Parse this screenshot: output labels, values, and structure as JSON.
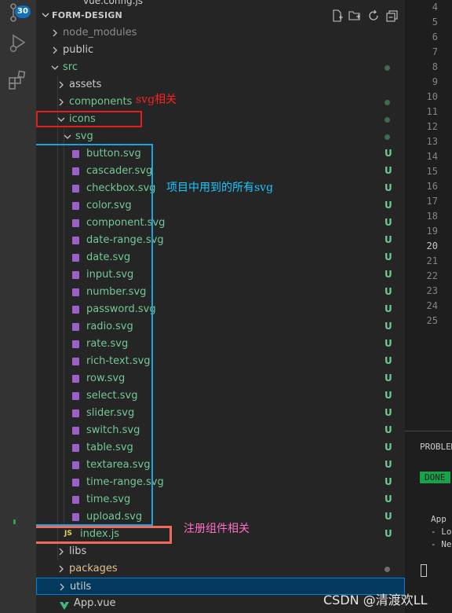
{
  "activity_bar": {
    "scm_badge": "30",
    "icons": [
      "source-control-icon",
      "run-debug-icon",
      "extensions-icon"
    ]
  },
  "explorer": {
    "partial_top_text": "vue.config.js",
    "section_title": "FORM-DESIGN",
    "header_actions": [
      "new-file-icon",
      "new-folder-icon",
      "refresh-icon",
      "collapse-all-icon"
    ],
    "rows": [
      {
        "label": "node_modules",
        "kind": "folder",
        "expanded": false,
        "depth": 0,
        "status": "",
        "color": "#8b8b8b"
      },
      {
        "label": "public",
        "kind": "folder",
        "expanded": false,
        "depth": 0,
        "status": "",
        "color": "#cccccc"
      },
      {
        "label": "src",
        "kind": "folder",
        "expanded": true,
        "depth": 0,
        "status": "dot",
        "color": "#73c991"
      },
      {
        "label": "assets",
        "kind": "folder",
        "expanded": false,
        "depth": 1,
        "status": "",
        "color": "#cccccc"
      },
      {
        "label": "components",
        "kind": "folder",
        "expanded": false,
        "depth": 1,
        "status": "dot",
        "color": "#73c991"
      },
      {
        "label": "icons",
        "kind": "folder",
        "expanded": true,
        "depth": 1,
        "status": "dot",
        "color": "#73c991"
      },
      {
        "label": "svg",
        "kind": "folder",
        "expanded": true,
        "depth": 2,
        "status": "dot",
        "color": "#73c991"
      },
      {
        "label": "button.svg",
        "kind": "svg",
        "depth": 3,
        "status": "U",
        "color": "#73c991"
      },
      {
        "label": "cascader.svg",
        "kind": "svg",
        "depth": 3,
        "status": "U",
        "color": "#73c991"
      },
      {
        "label": "checkbox.svg",
        "kind": "svg",
        "depth": 3,
        "status": "U",
        "color": "#73c991"
      },
      {
        "label": "color.svg",
        "kind": "svg",
        "depth": 3,
        "status": "U",
        "color": "#73c991"
      },
      {
        "label": "component.svg",
        "kind": "svg",
        "depth": 3,
        "status": "U",
        "color": "#73c991"
      },
      {
        "label": "date-range.svg",
        "kind": "svg",
        "depth": 3,
        "status": "U",
        "color": "#73c991"
      },
      {
        "label": "date.svg",
        "kind": "svg",
        "depth": 3,
        "status": "U",
        "color": "#73c991"
      },
      {
        "label": "input.svg",
        "kind": "svg",
        "depth": 3,
        "status": "U",
        "color": "#73c991"
      },
      {
        "label": "number.svg",
        "kind": "svg",
        "depth": 3,
        "status": "U",
        "color": "#73c991"
      },
      {
        "label": "password.svg",
        "kind": "svg",
        "depth": 3,
        "status": "U",
        "color": "#73c991"
      },
      {
        "label": "radio.svg",
        "kind": "svg",
        "depth": 3,
        "status": "U",
        "color": "#73c991"
      },
      {
        "label": "rate.svg",
        "kind": "svg",
        "depth": 3,
        "status": "U",
        "color": "#73c991"
      },
      {
        "label": "rich-text.svg",
        "kind": "svg",
        "depth": 3,
        "status": "U",
        "color": "#73c991"
      },
      {
        "label": "row.svg",
        "kind": "svg",
        "depth": 3,
        "status": "U",
        "color": "#73c991"
      },
      {
        "label": "select.svg",
        "kind": "svg",
        "depth": 3,
        "status": "U",
        "color": "#73c991"
      },
      {
        "label": "slider.svg",
        "kind": "svg",
        "depth": 3,
        "status": "U",
        "color": "#73c991"
      },
      {
        "label": "switch.svg",
        "kind": "svg",
        "depth": 3,
        "status": "U",
        "color": "#73c991"
      },
      {
        "label": "table.svg",
        "kind": "svg",
        "depth": 3,
        "status": "U",
        "color": "#73c991"
      },
      {
        "label": "textarea.svg",
        "kind": "svg",
        "depth": 3,
        "status": "U",
        "color": "#73c991"
      },
      {
        "label": "time-range.svg",
        "kind": "svg",
        "depth": 3,
        "status": "U",
        "color": "#73c991"
      },
      {
        "label": "time.svg",
        "kind": "svg",
        "depth": 3,
        "status": "U",
        "color": "#73c991"
      },
      {
        "label": "upload.svg",
        "kind": "svg",
        "depth": 3,
        "status": "U",
        "color": "#73c991"
      },
      {
        "label": "index.js",
        "kind": "js",
        "depth": 2,
        "status": "U",
        "color": "#73c991"
      },
      {
        "label": "libs",
        "kind": "folder",
        "expanded": false,
        "depth": 1,
        "status": "",
        "color": "#cccccc"
      },
      {
        "label": "packages",
        "kind": "folder",
        "expanded": false,
        "depth": 1,
        "status": "graydot",
        "color": "#e2c08d"
      },
      {
        "label": "utils",
        "kind": "folder",
        "expanded": false,
        "depth": 1,
        "status": "",
        "color": "#cccccc",
        "selected": true
      },
      {
        "label": "App.vue",
        "kind": "vue",
        "depth": 1,
        "status": "",
        "color": "#cccccc"
      }
    ]
  },
  "annotations": {
    "svg_related": {
      "text": "svg相关",
      "color": "#ff2020"
    },
    "all_svg_in_project": {
      "text": "项目中用到的所有svg",
      "color": "#19c8ff"
    },
    "register_component": {
      "text": "注册组件相关",
      "color": "#ff6ec7"
    },
    "red_box_color": "#e02020",
    "blue_box_color": "#1aa3e0",
    "orange_box_color": "#f06a5a"
  },
  "editor": {
    "line_numbers": [
      "4",
      "5",
      "6",
      "7",
      "8",
      "9",
      "10",
      "11",
      "12",
      "13",
      "14",
      "15",
      "16",
      "17",
      "18",
      "19",
      "20",
      "21",
      "22",
      "23",
      "24",
      "25"
    ],
    "current_line": "20"
  },
  "panel": {
    "tab_label": "PROBLEM",
    "status_badge": "DONE",
    "output_lines": [
      "App",
      "- Lo",
      "- Ne"
    ]
  },
  "watermark": "CSDN @清渡欢LL"
}
